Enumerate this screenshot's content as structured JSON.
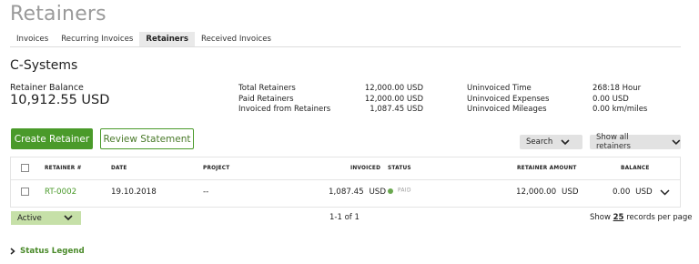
{
  "page_title": "Retainers",
  "tabs": [
    {
      "label": "Invoices"
    },
    {
      "label": "Recurring Invoices"
    },
    {
      "label": "Retainers",
      "active": true
    },
    {
      "label": "Received Invoices"
    }
  ],
  "client": {
    "name": "C-Systems",
    "balance_label": "Retainer Balance",
    "balance_value": "10,912.55 USD"
  },
  "summary_left": [
    {
      "label": "Total Retainers",
      "value": "12,000.00 USD"
    },
    {
      "label": "Paid Retainers",
      "value": "12,000.00 USD"
    },
    {
      "label": "Invoiced from Retainers",
      "value": "1,087.45 USD"
    }
  ],
  "summary_right": [
    {
      "label": "Uninvoiced Time",
      "value": "268:18 Hour"
    },
    {
      "label": "Uninvoiced Expenses",
      "value": "0.00 USD"
    },
    {
      "label": "Uninvoiced Mileages",
      "value": "0.00 km/miles"
    }
  ],
  "actions": {
    "create": "Create Retainer",
    "review": "Review Statement",
    "search": "Search",
    "filter": "Show all retainers"
  },
  "table": {
    "headers": {
      "number": "RETAINER #",
      "date": "DATE",
      "project": "PROJECT",
      "invoiced": "INVOICED",
      "status": "STATUS",
      "amount": "RETAINER AMOUNT",
      "balance": "BALANCE"
    },
    "rows": [
      {
        "number": "RT-0002",
        "date": "19.10.2018",
        "project": "--",
        "invoiced_amount": "1,087.45",
        "invoiced_currency": "USD",
        "status": "PAID",
        "amount_value": "12,000.00",
        "amount_currency": "USD",
        "balance_value": "0.00",
        "balance_currency": "USD"
      }
    ]
  },
  "footer": {
    "status_select": "Active",
    "pagination": "1-1 of 1",
    "per_page_prefix": "Show",
    "per_page_count": "25",
    "per_page_suffix": "records per page"
  },
  "status_legend": "Status Legend",
  "colors": {
    "accent": "#4a9a2a",
    "active_select_bg": "#c6e0a8",
    "paid_dot": "#6aa84f"
  },
  "icons": [
    "chevron-down-icon",
    "chevron-right-icon",
    "checkbox-icon",
    "status-dot-icon"
  ]
}
